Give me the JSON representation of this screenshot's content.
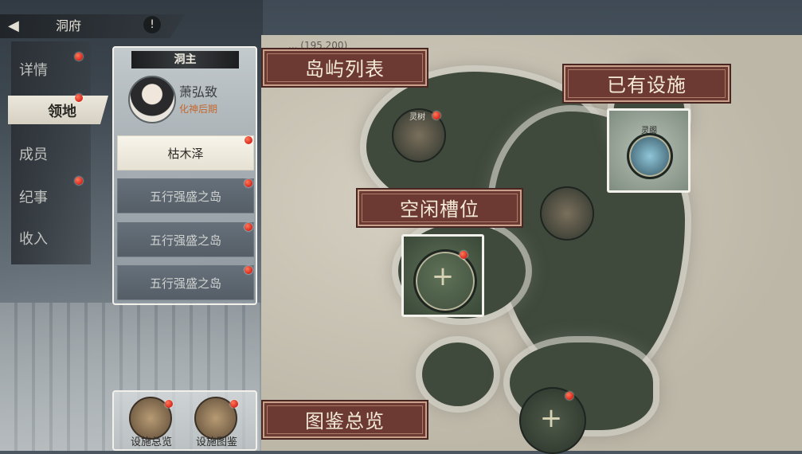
{
  "header": {
    "title": "洞府",
    "help_glyph": "!"
  },
  "side_menu": {
    "items": [
      {
        "label": "详情",
        "badge": true
      },
      {
        "label": "领地",
        "badge": true,
        "active": true
      },
      {
        "label": "成员",
        "badge": false
      },
      {
        "label": "纪事",
        "badge": true
      },
      {
        "label": "收入",
        "badge": false
      }
    ]
  },
  "panel": {
    "owner_title": "洞主",
    "owner_name": "萧弘致",
    "owner_realm": "化神后期",
    "islands": [
      {
        "label": "枯木泽",
        "selected": true
      },
      {
        "label": "五行强盛之岛",
        "selected": false
      },
      {
        "label": "五行强盛之岛",
        "selected": false
      },
      {
        "label": "五行强盛之岛",
        "selected": false
      }
    ]
  },
  "map": {
    "header_text": "... (195,200)",
    "nodes": [
      {
        "label": "灵树"
      },
      {
        "label": "灵阁"
      }
    ]
  },
  "annotations": {
    "island_list": "岛屿列表",
    "existing_facilities": "已有设施",
    "empty_slot": "空闲槽位",
    "codex_overview": "图鉴总览"
  },
  "bottom": {
    "facility_overview": "设施总览",
    "facility_codex": "设施图鉴"
  },
  "colors": {
    "annotation_bg": "#6d3a33",
    "badge_red": "#d8271c",
    "realm_text": "#c4682e"
  }
}
